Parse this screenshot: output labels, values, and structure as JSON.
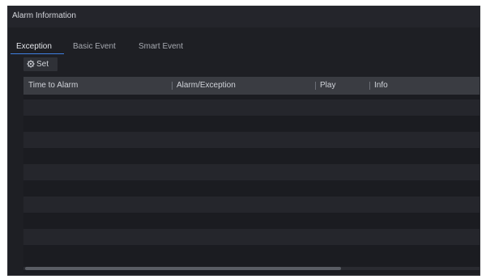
{
  "window": {
    "title": "Alarm Information"
  },
  "tabs": [
    {
      "label": "Exception",
      "active": true
    },
    {
      "label": "Basic Event",
      "active": false
    },
    {
      "label": "Smart Event",
      "active": false
    }
  ],
  "toolbar": {
    "set_label": "Set",
    "set_icon": "gear-icon"
  },
  "table": {
    "columns": [
      "Time to Alarm",
      "Alarm/Exception",
      "Play",
      "Info"
    ],
    "rows": []
  },
  "colors": {
    "background": "#1e1f24",
    "header": "#3a3c42",
    "accent": "#3f7fe0"
  }
}
